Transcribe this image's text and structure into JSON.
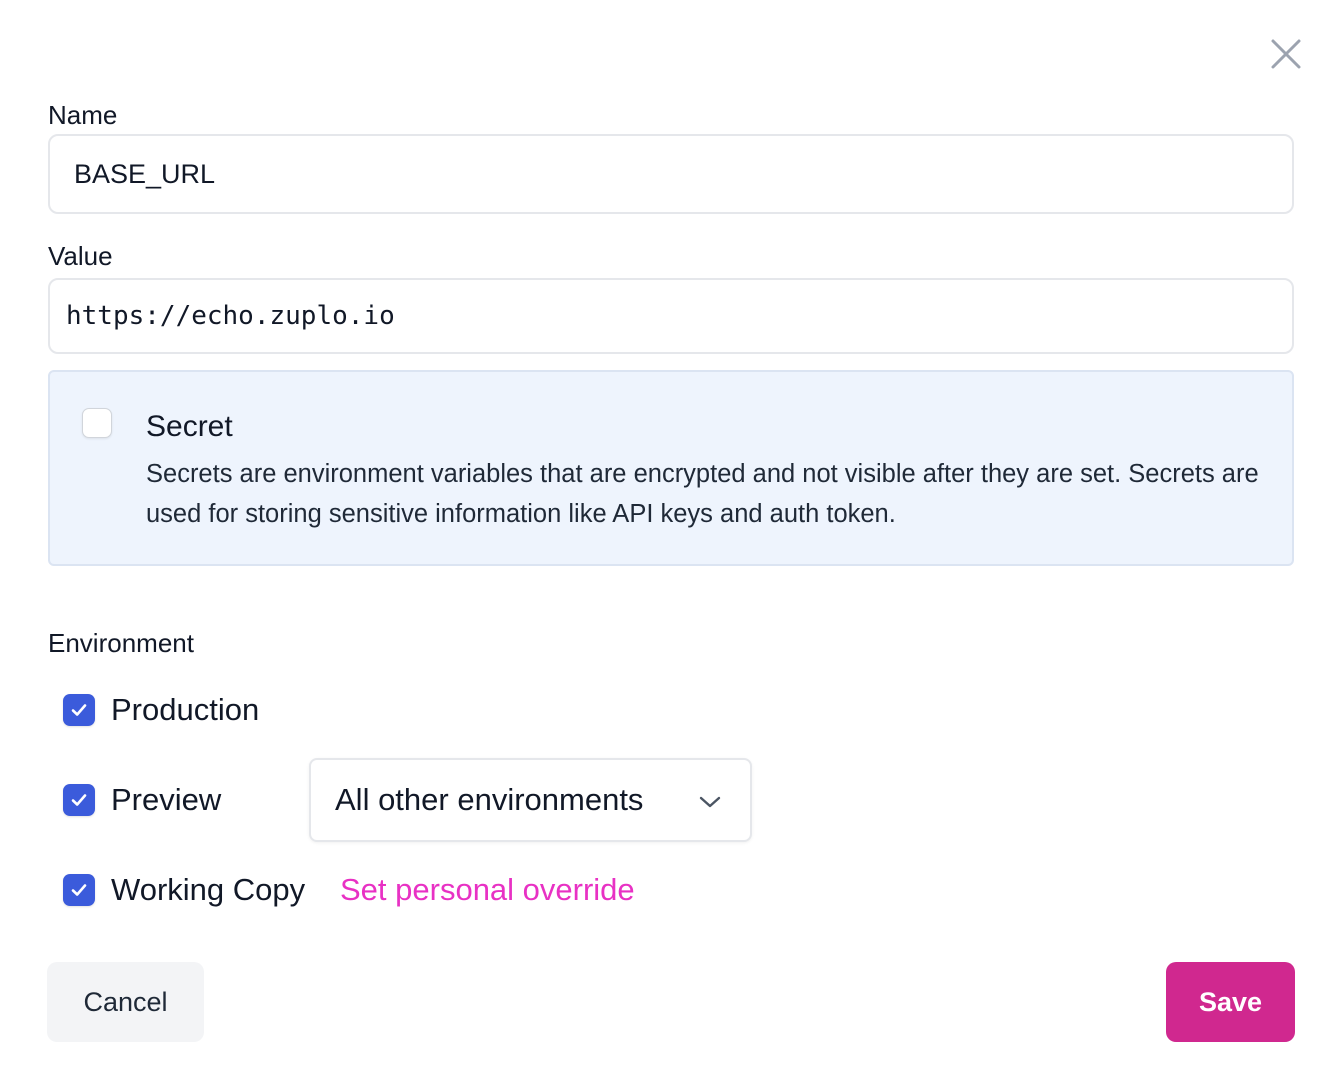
{
  "dialog": {
    "close_icon": "close-icon"
  },
  "form": {
    "name": {
      "label": "Name",
      "value": "BASE_URL"
    },
    "value": {
      "label": "Value",
      "value": "https://echo.zuplo.io"
    },
    "secret": {
      "checked": false,
      "title": "Secret",
      "description": "Secrets are environment variables that are encrypted and not visible after they are set. Secrets are used for storing sensitive information like API keys and auth token."
    },
    "environment": {
      "label": "Environment",
      "production": {
        "label": "Production",
        "checked": true
      },
      "preview": {
        "label": "Preview",
        "checked": true,
        "select_value": "All other environments"
      },
      "working_copy": {
        "label": "Working Copy",
        "checked": true,
        "override_link": "Set personal override"
      }
    }
  },
  "actions": {
    "cancel_label": "Cancel",
    "save_label": "Save"
  },
  "colors": {
    "checkbox_accent": "#3b5bdb",
    "save_button": "#d0288f",
    "link": "#e831c4",
    "secret_panel_bg": "#eef4fd"
  }
}
